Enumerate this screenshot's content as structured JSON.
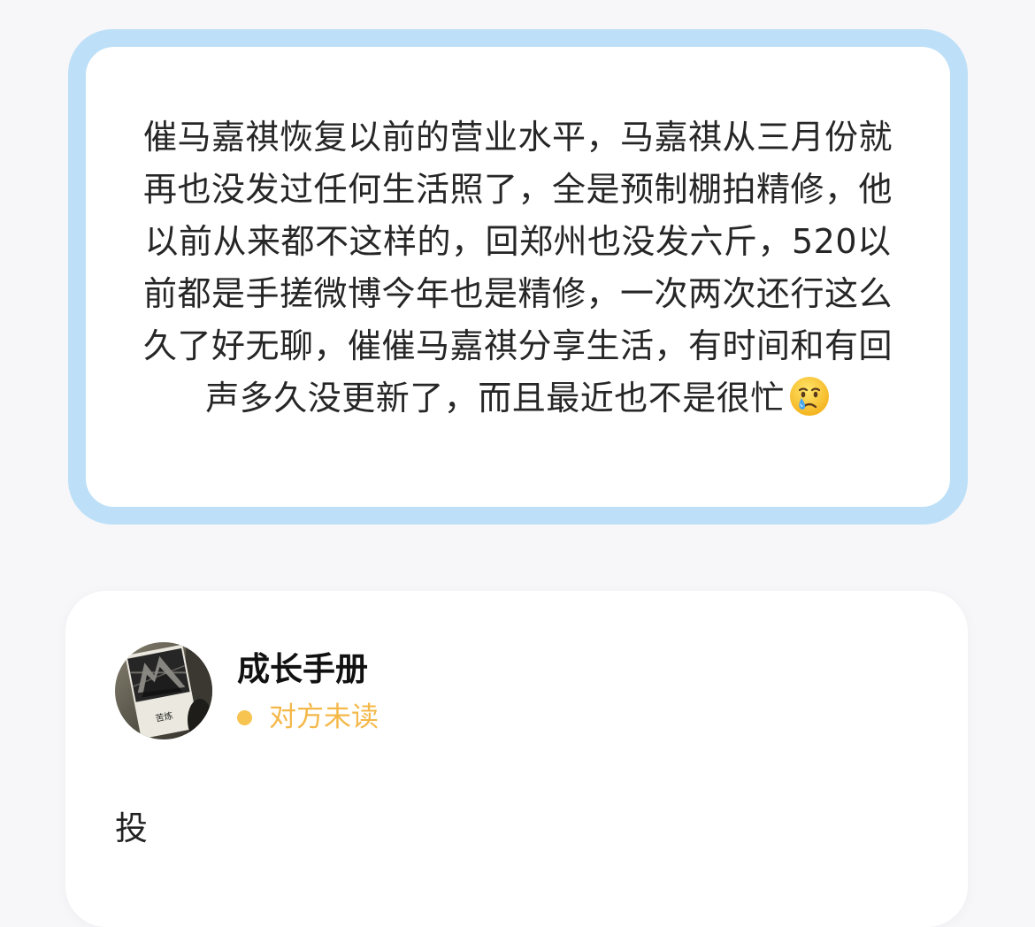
{
  "question": {
    "text": "催马嘉祺恢复以前的营业水平，马嘉祺从三月份就再也没发过任何生活照了，全是预制棚拍精修，他以前从来都不这样的，回郑州也没发六斤，520以前都是手搓微博今年也是精修，一次两次还行这么久了好无聊，催催马嘉祺分享生活，有时间和有回声多久没更新了，而且最近也不是很忙",
    "emoji_icon": "crying-face-with-tear-icon"
  },
  "reply": {
    "username": "成长手册",
    "status": "对方未读",
    "status_color": "#f8c451",
    "avatar_icon": "book-cover-avatar-icon",
    "avatar_book_text": "苦炼",
    "body": "投"
  },
  "colors": {
    "card_border": "#bde0f8",
    "background": "#f7f7f9"
  }
}
